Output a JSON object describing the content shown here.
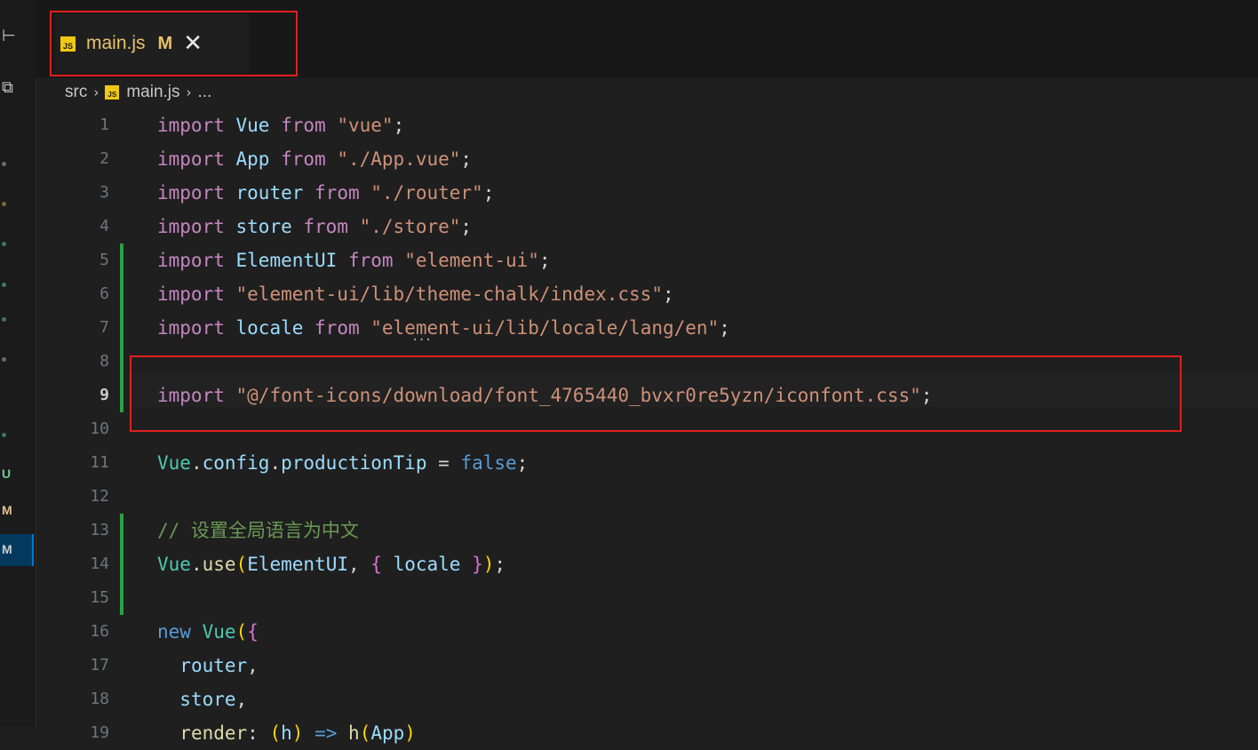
{
  "tab": {
    "icon_text": "JS",
    "title": "main.js",
    "modified": "M",
    "close": "✕"
  },
  "breadcrumb": {
    "folder": "src",
    "sep": "›",
    "icon_text": "JS",
    "file": "main.js",
    "more": "..."
  },
  "sidebar_strip": {
    "letter_u": "U",
    "letter_m1": "M",
    "letter_m2": "M"
  },
  "code_lines": [
    {
      "n": "1",
      "t": "import Vue from \"vue\";"
    },
    {
      "n": "2",
      "t": "import App from \"./App.vue\";"
    },
    {
      "n": "3",
      "t": "import router from \"./router\";"
    },
    {
      "n": "4",
      "t": "import store from \"./store\";"
    },
    {
      "n": "5",
      "t": "import ElementUI from \"element-ui\";"
    },
    {
      "n": "6",
      "t": "import \"element-ui/lib/theme-chalk/index.css\";"
    },
    {
      "n": "7",
      "t": "import locale from \"element-ui/lib/locale/lang/en\";"
    },
    {
      "n": "8",
      "t": ""
    },
    {
      "n": "9",
      "t": "import \"@/font-icons/download/font_4765440_bvxr0re5yzn/iconfont.css\";"
    },
    {
      "n": "10",
      "t": ""
    },
    {
      "n": "11",
      "t": "Vue.config.productionTip = false;"
    },
    {
      "n": "12",
      "t": ""
    },
    {
      "n": "13",
      "t": "// 设置全局语言为中文"
    },
    {
      "n": "14",
      "t": "Vue.use(ElementUI, { locale });"
    },
    {
      "n": "15",
      "t": ""
    },
    {
      "n": "16",
      "t": "new Vue({"
    },
    {
      "n": "17",
      "t": "  router,"
    },
    {
      "n": "18",
      "t": "  store,"
    },
    {
      "n": "19",
      "t": "  render: (h) => h(App)"
    }
  ],
  "hint_ellipsis": "...",
  "colors": {
    "keyword": "#c586c0",
    "variable": "#9cdcfe",
    "string": "#ce9178",
    "comment": "#6a9955",
    "function": "#dcdcaa",
    "class": "#4ec9b0",
    "boolean": "#569cd6",
    "added_gutter": "#2ea043",
    "highlight_box": "#e0201c",
    "tab_title": "#e8c36a"
  }
}
